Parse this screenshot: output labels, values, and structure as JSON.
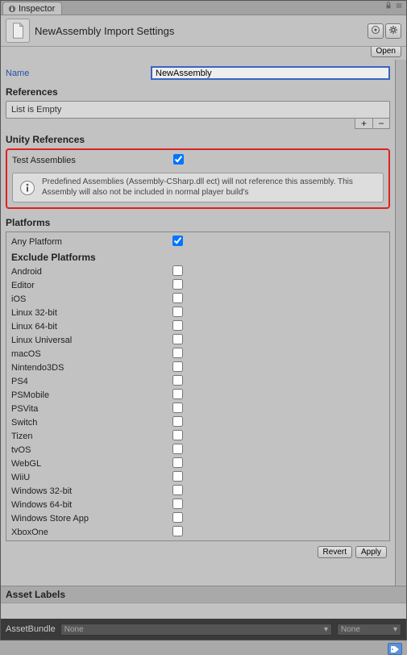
{
  "tab": {
    "label": "Inspector"
  },
  "header": {
    "title": "NewAssembly Import Settings",
    "open_btn": "Open"
  },
  "name_field": {
    "label": "Name",
    "value": "NewAssembly"
  },
  "references": {
    "title": "References",
    "empty_text": "List is Empty"
  },
  "unity_refs": {
    "title": "Unity References",
    "test_label": "Test Assemblies",
    "test_checked": true,
    "info": "Predefined Assemblies (Assembly-CSharp.dll ect) will not reference this assembly. This Assembly will also not be included in normal player build's"
  },
  "platforms": {
    "title": "Platforms",
    "any_label": "Any Platform",
    "any_checked": true,
    "exclude_title": "Exclude Platforms",
    "items": [
      {
        "label": "Android",
        "checked": false
      },
      {
        "label": "Editor",
        "checked": false
      },
      {
        "label": "iOS",
        "checked": false
      },
      {
        "label": "Linux 32-bit",
        "checked": false
      },
      {
        "label": "Linux 64-bit",
        "checked": false
      },
      {
        "label": "Linux Universal",
        "checked": false
      },
      {
        "label": "macOS",
        "checked": false
      },
      {
        "label": "Nintendo3DS",
        "checked": false
      },
      {
        "label": "PS4",
        "checked": false
      },
      {
        "label": "PSMobile",
        "checked": false
      },
      {
        "label": "PSVita",
        "checked": false
      },
      {
        "label": "Switch",
        "checked": false
      },
      {
        "label": "Tizen",
        "checked": false
      },
      {
        "label": "tvOS",
        "checked": false
      },
      {
        "label": "WebGL",
        "checked": false
      },
      {
        "label": "WiiU",
        "checked": false
      },
      {
        "label": "Windows 32-bit",
        "checked": false
      },
      {
        "label": "Windows 64-bit",
        "checked": false
      },
      {
        "label": "Windows Store App",
        "checked": false
      },
      {
        "label": "XboxOne",
        "checked": false
      }
    ]
  },
  "footer": {
    "revert": "Revert",
    "apply": "Apply"
  },
  "asset_labels": {
    "title": "Asset Labels"
  },
  "assetbundle": {
    "label": "AssetBundle",
    "value": "None",
    "variant": "None"
  }
}
